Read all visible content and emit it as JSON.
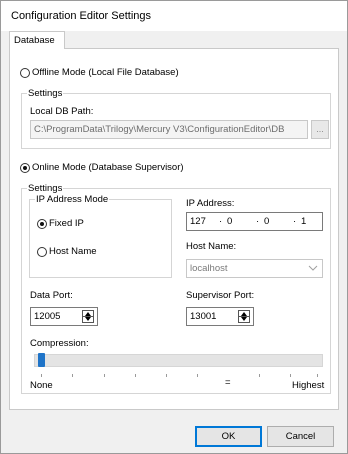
{
  "window": {
    "title": "Configuration Editor Settings"
  },
  "tabs": [
    {
      "label": "Database"
    }
  ],
  "offline": {
    "radio_label": "Offline Mode (Local File Database)",
    "selected": false,
    "settings_legend": "Settings",
    "local_db_label": "Local DB Path:",
    "local_db_value": "C:\\ProgramData\\Trilogy\\Mercury V3\\ConfigurationEditor\\DB",
    "browse_label": "..."
  },
  "online": {
    "radio_label": "Online Mode (Database Supervisor)",
    "selected": true,
    "settings_legend": "Settings",
    "ip_mode": {
      "legend": "IP Address Mode",
      "fixed_ip_label": "Fixed IP",
      "fixed_ip_selected": true,
      "host_name_label": "Host Name",
      "host_name_selected": false
    },
    "ip_address_label": "IP Address:",
    "ip_octets": [
      "127",
      "0",
      "0",
      "1"
    ],
    "host_name_label": "Host Name:",
    "host_name_value": "localhost",
    "data_port_label": "Data Port:",
    "data_port_value": "12005",
    "supervisor_port_label": "Supervisor Port:",
    "supervisor_port_value": "13001",
    "compression_label": "Compression:",
    "compression_level": 0,
    "compression_min_label": "None",
    "compression_mid_label": "=",
    "compression_max_label": "Highest"
  },
  "buttons": {
    "ok": "OK",
    "cancel": "Cancel"
  }
}
